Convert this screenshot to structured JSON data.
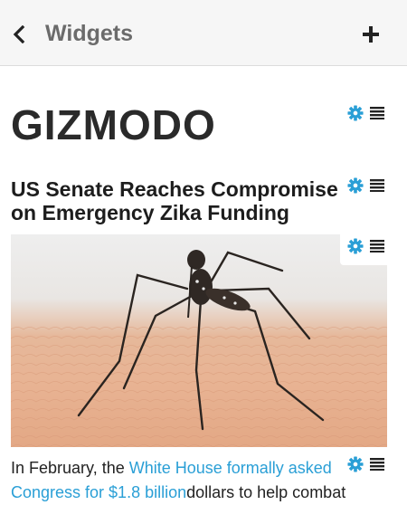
{
  "header": {
    "back_icon": "chevron-left-icon",
    "title": "Widgets",
    "add_icon": "plus-icon"
  },
  "widget_icons": {
    "settings": "gear-icon",
    "menu": "list-icon",
    "accent": "#2a9fd6"
  },
  "feed": {
    "brand": "GIZMODO",
    "article": {
      "title_line1": "US Senate Reaches Compromise",
      "title_line2": "on Emergency Zika Funding",
      "image_description": "mosquito",
      "summary": {
        "before": "In February, the ",
        "link1": "White House formally asked",
        "link2": "Congress for $1.8 billion",
        "after": "dollars to help combat"
      }
    }
  }
}
